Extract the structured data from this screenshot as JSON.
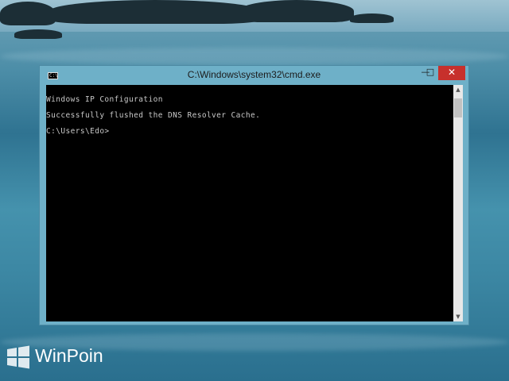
{
  "window": {
    "title": "C:\\Windows\\system32\\cmd.exe",
    "icon": "cmd-icon",
    "controls": {
      "minimize": "—",
      "maximize": "□",
      "close": "✕"
    }
  },
  "console": {
    "lines": [
      "Windows IP Configuration",
      "Successfully flushed the DNS Resolver Cache.",
      "C:\\Users\\Edo>"
    ]
  },
  "scrollbar": {
    "up": "▲",
    "down": "▼"
  },
  "watermark": {
    "text": "WinPoin"
  }
}
